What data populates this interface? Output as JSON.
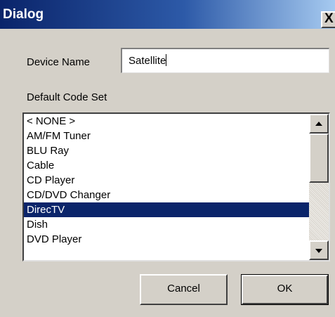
{
  "window": {
    "title": "Dialog",
    "close_glyph": "X",
    "titlebar_color": "#0a246a"
  },
  "device_name": {
    "label": "Device Name",
    "value": "Satellite"
  },
  "code_set": {
    "label": "Default Code Set",
    "items": [
      "< NONE >",
      "AM/FM Tuner",
      "BLU Ray",
      "Cable",
      "CD Player",
      "CD/DVD Changer",
      "DirecTV",
      "Dish",
      "DVD Player"
    ],
    "selected": "DirecTV",
    "selection_color": "#0a246a"
  },
  "buttons": {
    "cancel": "Cancel",
    "ok": "OK"
  },
  "icons": {
    "scroll_up": "scroll-up-arrow",
    "scroll_down": "scroll-down-arrow",
    "close": "close-x"
  }
}
